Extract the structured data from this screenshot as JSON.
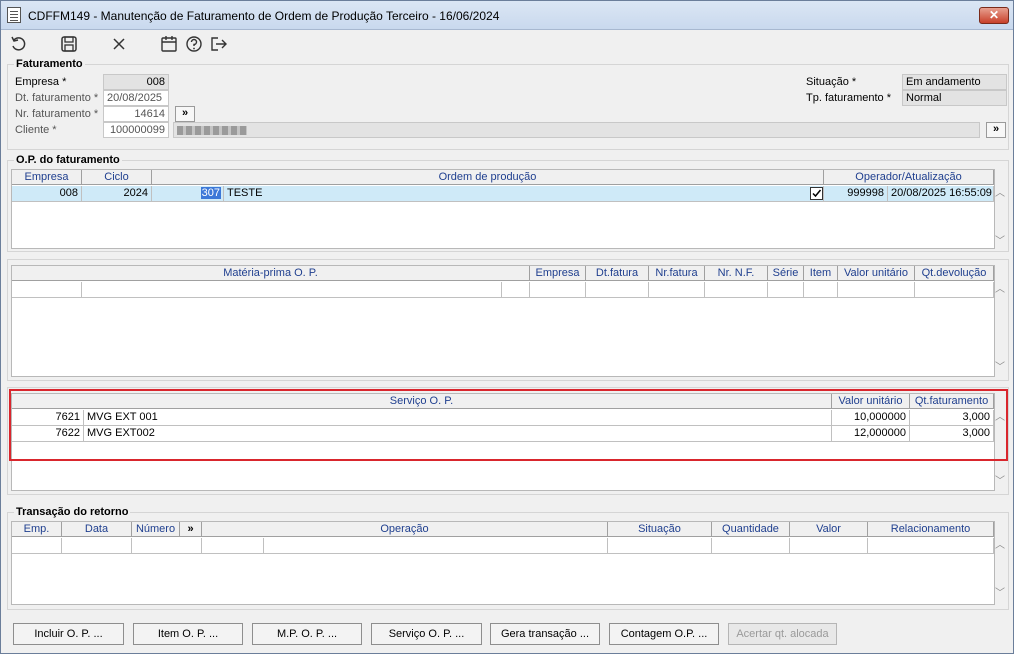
{
  "window": {
    "title": "CDFFM149 - Manutenção de Faturamento de Ordem de Produção Terceiro - 16/06/2024",
    "close_label": "✕"
  },
  "toolbar": {
    "icons": [
      "refresh-icon",
      "save-icon",
      "cancel-icon",
      "calendar-icon",
      "help-icon",
      "exit-icon"
    ]
  },
  "faturamento": {
    "title": "Faturamento",
    "empresa_label": "Empresa *",
    "empresa_value": "008",
    "dt_label": "Dt. faturamento *",
    "dt_value": "20/08/2025",
    "nr_label": "Nr. faturamento *",
    "nr_value": "14614",
    "cliente_label": "Cliente *",
    "cliente_value": "100000099",
    "cliente_name": "",
    "situacao_label": "Situação *",
    "situacao_value": "Em andamento",
    "tp_label": "Tp. faturamento *",
    "tp_value": "Normal",
    "more_button": "»"
  },
  "op_faturamento": {
    "title": "O.P. do faturamento",
    "headers": {
      "empresa": "Empresa",
      "ciclo": "Ciclo",
      "ordem": "Ordem de produção",
      "operador": "Operador/Atualização"
    },
    "row": {
      "empresa": "008",
      "ciclo": "2024",
      "ordem_num": "307",
      "ordem_desc": "TESTE",
      "operador": "999998",
      "atualizacao": "20/08/2025 16:55:09"
    }
  },
  "materia_prima": {
    "headers": {
      "materia": "Matéria-prima O. P.",
      "empresa": "Empresa",
      "dt_fatura": "Dt.fatura",
      "nr_fatura": "Nr.fatura",
      "nr_nf": "Nr. N.F.",
      "serie": "Série",
      "item": "Item",
      "valor_unit": "Valor unitário",
      "qt_dev": "Qt.devolução"
    }
  },
  "servico": {
    "headers": {
      "servico": "Serviço O. P.",
      "valor_unit": "Valor unitário",
      "qt_fat": "Qt.faturamento"
    },
    "rows": [
      {
        "code": "7621",
        "desc": "MVG EXT 001",
        "valor": "10,000000",
        "qt": "3,000"
      },
      {
        "code": "7622",
        "desc": "MVG EXT002",
        "valor": "12,000000",
        "qt": "3,000"
      }
    ]
  },
  "transacao": {
    "title": "Transação do retorno",
    "headers": {
      "emp": "Emp.",
      "data": "Data",
      "numero": "Número",
      "more": "»",
      "operacao": "Operação",
      "situacao": "Situação",
      "quantidade": "Quantidade",
      "valor": "Valor",
      "relacionamento": "Relacionamento"
    }
  },
  "buttons": {
    "incluir": "Incluir O. P. ...",
    "item": "Item O. P. ...",
    "mp": "M.P. O. P. ...",
    "servico": "Serviço O. P. ...",
    "gera": "Gera transação ...",
    "contagem": "Contagem O.P. ...",
    "acertar": "Acertar qt. alocada"
  },
  "colors": {
    "highlight": "#d9262d",
    "header_text": "#1f3f8f",
    "selected_row": "#cfeaf8"
  }
}
